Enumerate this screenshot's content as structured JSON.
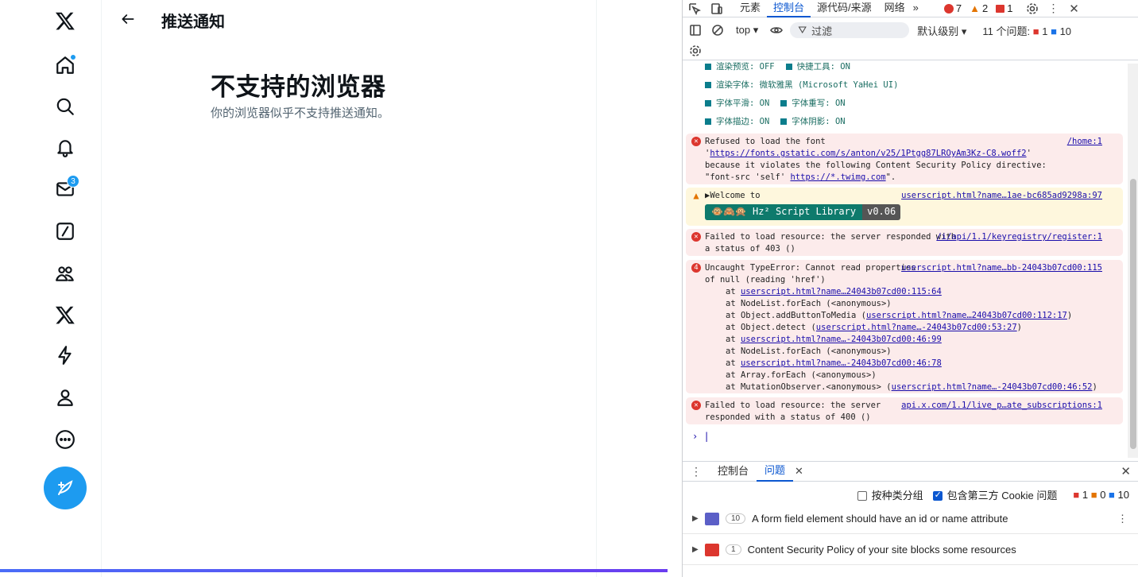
{
  "x": {
    "header_title": "推送通知",
    "unsupported_title": "不支持的浏览器",
    "unsupported_subtitle": "你的浏览器似乎不支持推送通知。",
    "messages_badge": "3",
    "accent_color": "#1d9bf0"
  },
  "devtools": {
    "tabs": [
      "元素",
      "控制台",
      "源代码/来源",
      "网络"
    ],
    "active_tab": "控制台",
    "counts": {
      "errors": "7",
      "warnings": "2",
      "issues": "1"
    },
    "context": "top",
    "filter_placeholder": "过滤",
    "level": "默认级别",
    "issues_summary": "11 个问题:",
    "issues_err": "1",
    "issues_info": "10",
    "config_lines": [
      [
        "渲染预览: OFF",
        "快捷工具: ON"
      ],
      [
        "渲染字体: 微软雅黑 (Microsoft YaHei UI)"
      ],
      [
        "字体平滑: ON",
        "字体重写: ON"
      ],
      [
        "字体描边: ON",
        "字体阴影: ON"
      ]
    ],
    "msg1": {
      "text1": "Refused to load the font '",
      "link1": "https://fonts.gstatic.com/s/anton/v25/1Ptgg87LROyAm3Kz-C8.woff2",
      "text2": "' because it violates the following Content Security Policy directive: \"font-src 'self'",
      "link2": "https://*.twimg.com",
      "text3": "\".",
      "source": "/home:1"
    },
    "msg2": {
      "text": "▶Welcome to",
      "source": "userscript.html?name…1ae-bc685ad9298a:97",
      "badge_left": "🐵🙈🙊 Hz² Script Library",
      "badge_right": "v0.06"
    },
    "msg3": {
      "text": "Failed to load resource: the server responded with a status of 403 ()",
      "source": "/i/api/1.1/keyregistry/register:1"
    },
    "msg4": {
      "count": "4",
      "text": "Uncaught TypeError: Cannot read properties of null (reading 'href')",
      "source": "userscript.html?name…bb-24043b07cd00:115",
      "stack": [
        {
          "pre": "at ",
          "link": "userscript.html?name…24043b07cd00:115:64",
          "post": ""
        },
        {
          "pre": "at NodeList.forEach (<anonymous>)",
          "link": "",
          "post": ""
        },
        {
          "pre": "at Object.addButtonToMedia (",
          "link": "userscript.html?name…24043b07cd00:112:17",
          "post": ")"
        },
        {
          "pre": "at Object.detect (",
          "link": "userscript.html?name…-24043b07cd00:53:27",
          "post": ")"
        },
        {
          "pre": "at ",
          "link": "userscript.html?name…-24043b07cd00:46:99",
          "post": ""
        },
        {
          "pre": "at NodeList.forEach (<anonymous>)",
          "link": "",
          "post": ""
        },
        {
          "pre": "at ",
          "link": "userscript.html?name…-24043b07cd00:46:78",
          "post": ""
        },
        {
          "pre": "at Array.forEach (<anonymous>)",
          "link": "",
          "post": ""
        },
        {
          "pre": "at MutationObserver.<anonymous> (",
          "link": "userscript.html?name…-24043b07cd00:46:52",
          "post": ")"
        }
      ]
    },
    "msg5": {
      "text": "Failed to load resource: the server responded with a status of 400 ()",
      "source": "api.x.com/1.1/live_p…ate_subscriptions:1"
    },
    "drawer": {
      "tabs": [
        "控制台",
        "问题"
      ],
      "active": "问题",
      "group_by_kind": "按种类分组",
      "include_third_party": "包含第三方 Cookie 问题",
      "c_err": "1",
      "c_warn": "0",
      "c_info": "10",
      "issues": [
        {
          "count": "10",
          "text": "A form field element should have an id or name attribute"
        },
        {
          "count": "1",
          "text": "Content Security Policy of your site blocks some resources"
        }
      ]
    }
  }
}
